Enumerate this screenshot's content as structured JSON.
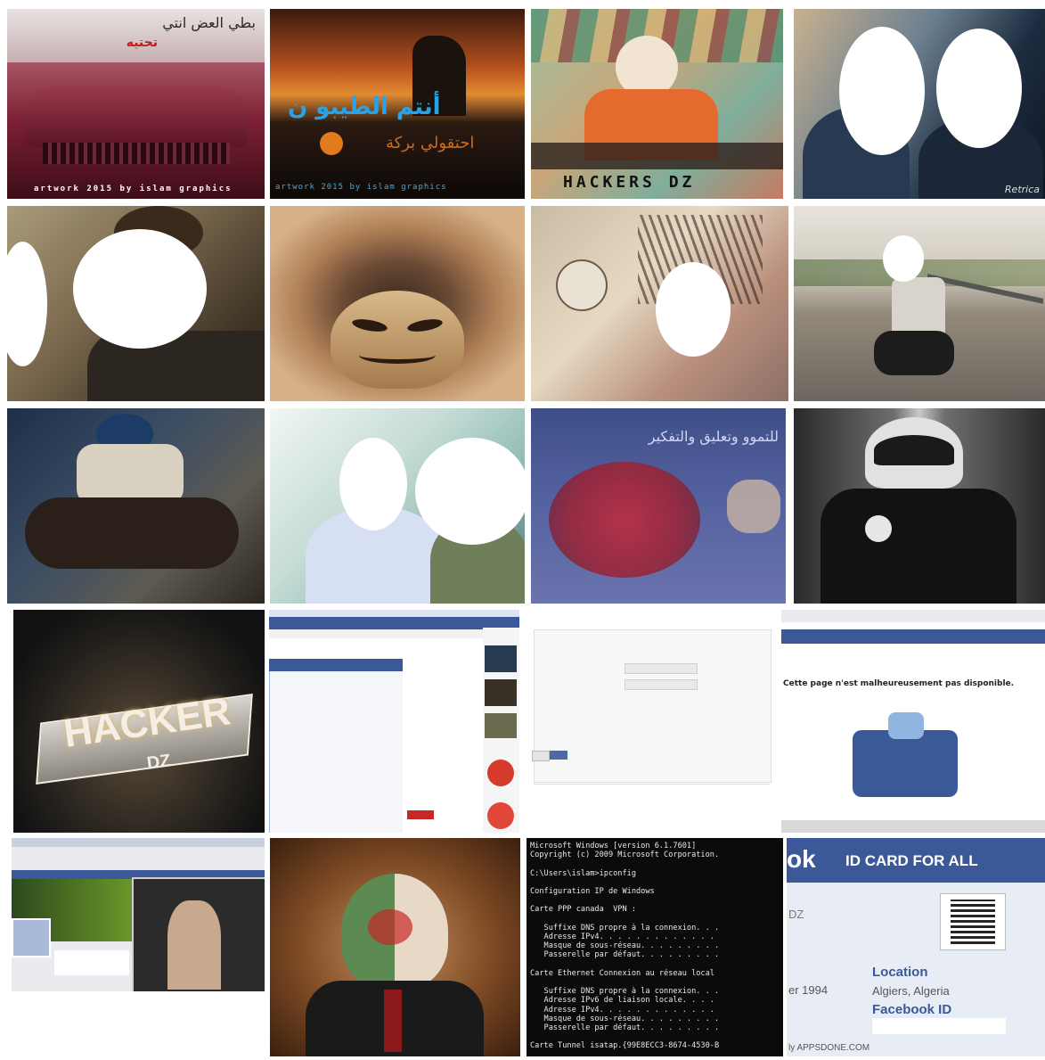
{
  "tiles": {
    "t1": {
      "line1": "بطي العض انتي",
      "line2": "تحتيه",
      "bottom": "artwork 2015 by islam graphics"
    },
    "t2": {
      "line1": "أنتم الطيبو ن",
      "line2": "احتقولي بركة",
      "bottom": "artwork 2015 by islam graphics"
    },
    "t3": {
      "line1": "HACKERS DZ"
    },
    "t4": {
      "watermark": "Retrica"
    },
    "t11": {
      "line1": "للتموو وتعليق والتفكير"
    },
    "t13": {
      "logo": "HACKER",
      "sub": "DZ"
    },
    "t16": {
      "line1": "Cette page n'est malheureusement pas disponible."
    },
    "t19": {
      "lines": [
        "Microsoft Windows [version 6.1.7601]",
        "Copyright (c) 2009 Microsoft Corporation.",
        "",
        "C:\\Users\\islam>ipconfig",
        "",
        "Configuration IP de Windows",
        "",
        "Carte PPP canada  VPN :",
        "",
        "   Suffixe DNS propre à la connexion. . .",
        "   Adresse IPv4. . . . . . . . . . . . .",
        "   Masque de sous-réseau. . . . . . . . .",
        "   Passerelle par défaut. . . . . . . . .",
        "",
        "Carte Ethernet Connexion au réseau local",
        "",
        "   Suffixe DNS propre à la connexion. . .",
        "   Adresse IPv6 de liaison locale. . . .",
        "   Adresse IPv4. . . . . . . . . . . . .",
        "   Masque de sous-réseau. . . . . . . . .",
        "   Passerelle par défaut. . . . . . . . .",
        "",
        "Carte Tunnel isatap.{99E8ECC3-8674-4530-B"
      ]
    },
    "t20": {
      "brand": "ok",
      "title": "ID CARD FOR ALL",
      "dz": "DZ",
      "year": "er 1994",
      "loc_label": "Location",
      "loc_value": "Algiers, Algeria",
      "fbid": "Facebook ID",
      "footer": "ly APPSDONE.COM"
    }
  },
  "colors": {
    "fb_blue": "#3b5998",
    "console_bg": "#0b0b0b",
    "console_fg": "#e8e8e8"
  }
}
